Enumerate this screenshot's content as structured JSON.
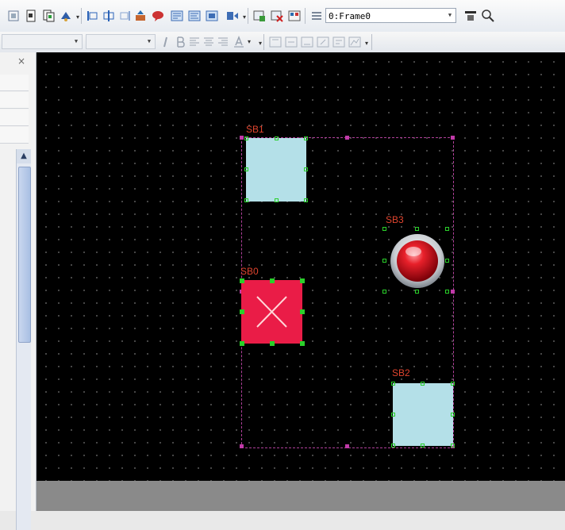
{
  "toolbar": {
    "frame_select_value": "0:Frame0"
  },
  "panel": {
    "close_glyph": "×",
    "scroll_up_glyph": "▲"
  },
  "canvas": {
    "objects": [
      {
        "id": "sb0",
        "label": "SB0",
        "kind": "pushbutton-red-x",
        "fill": "#ea1c47"
      },
      {
        "id": "sb1",
        "label": "SB1",
        "kind": "square-button",
        "fill": "#b4e0e8"
      },
      {
        "id": "sb2",
        "label": "SB2",
        "kind": "square-button",
        "fill": "#b4e0e8"
      },
      {
        "id": "sb3",
        "label": "SB3",
        "kind": "round-red-lamp",
        "fill": "#d0101c"
      }
    ]
  },
  "colors": {
    "canvas_bg": "#000000",
    "grid_dot": "#6a6a6a",
    "selection": "#b0409a",
    "handle": "#2ad02a",
    "label": "#e0442e"
  }
}
